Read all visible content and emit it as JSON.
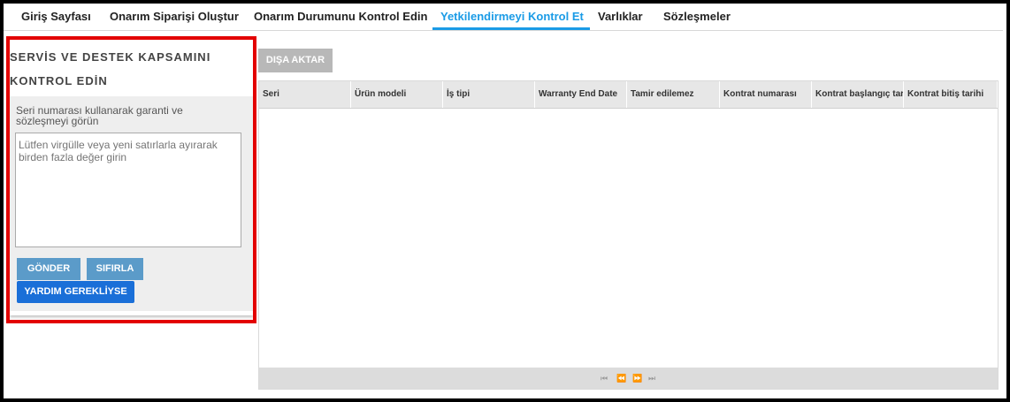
{
  "nav": {
    "tabs": [
      {
        "label": "Giriş Sayfası"
      },
      {
        "label": "Onarım Siparişi Oluştur"
      },
      {
        "label": "Onarım Durumunu Kontrol Edin"
      },
      {
        "label": "Yetkilendirmeyi Kontrol Et"
      },
      {
        "label": "Varlıklar"
      },
      {
        "label": "Sözleşmeler"
      }
    ],
    "active_tab": "Yetkilendirmeyi Kontrol Et"
  },
  "panel": {
    "title_line1": "SERVİS VE DESTEK KAPSAMINI",
    "title_line2": "KONTROL EDİN",
    "description": "Seri numarası kullanarak garanti ve sözleşmeyi görün",
    "textarea_placeholder": "Lütfen virgülle veya yeni satırlarla ayırarak birden fazla değer girin",
    "send_label": "GÖNDER",
    "reset_label": "SIFIRLA",
    "help_label": "YARDIM GEREKLİYSE"
  },
  "grid": {
    "export_label": "DIŞA AKTAR",
    "columns": [
      "Seri",
      "Ürün modeli",
      "İş tipi",
      "Warranty End Date",
      "Tamir edilemez",
      "Kontrat numarası",
      "Kontrat başlangıç tarihi",
      "Kontrat bitiş tarihi"
    ],
    "rows": [],
    "pager": {
      "first": "⏮",
      "prev": "⏪",
      "next": "⏩",
      "last": "⏭"
    }
  },
  "colors": {
    "accent": "#1a9be6",
    "highlight": "#e30000",
    "button": "#5b9bc9",
    "help_button": "#1a6fd8"
  }
}
